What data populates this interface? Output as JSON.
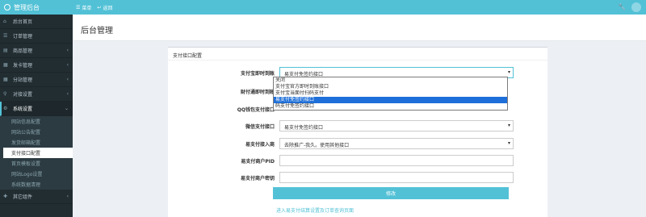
{
  "brand": "管理后台",
  "topnav": [
    {
      "label": "菜单",
      "icon": "menu-icon"
    },
    {
      "label": "返回",
      "icon": "back-icon"
    }
  ],
  "sidebar": {
    "items": [
      {
        "label": "后台首页",
        "icon": "dashboard-icon"
      },
      {
        "label": "订单管理",
        "icon": "list-icon"
      },
      {
        "label": "商品管理",
        "icon": "cart-icon",
        "chevron": "‹"
      },
      {
        "label": "发卡管理",
        "icon": "grid-icon",
        "chevron": "‹"
      },
      {
        "label": "分站管理",
        "icon": "grid-icon",
        "chevron": "‹"
      },
      {
        "label": "对接设置",
        "icon": "link-icon",
        "chevron": "‹"
      },
      {
        "label": "系统设置",
        "icon": "gear-icon",
        "chevron": "⌄"
      }
    ],
    "submenu": [
      "网站信息配置",
      "网站公告配置",
      "发货邮箱配置",
      "支付接口配置",
      "首页模板设置",
      "网站Logo设置",
      "系统数据清理"
    ],
    "last": {
      "label": "其它组件",
      "icon": "puzzle-icon",
      "chevron": "‹"
    }
  },
  "page_title": "后台管理",
  "card_title": "支付接口配置",
  "form": {
    "alipay_label": "支付宝即时到账",
    "alipay_value": "易支付免签约接口",
    "wechat_pay_label": "财付通即时到账",
    "qq_label": "QQ钱包支付接口",
    "wx_label": "微信支付接口",
    "wx_value": "易支付免签约接口",
    "epay_entry_label": "易支付接入商",
    "epay_entry_value": "去除推广-我久。使用其他接口",
    "epay_pid_label": "易支付商户PID",
    "epay_key_label": "易支付商户密钥",
    "submit_label": "修改",
    "link_text": "进入易支付结算设置及订单查询页面"
  },
  "dropdown_options": [
    "关闭",
    "支付宝官方即时到账接口",
    "支付宝当面付扫码支付",
    "易支付免签约接口",
    "码支付免签约接口"
  ],
  "dropdown_selected_index": 3
}
